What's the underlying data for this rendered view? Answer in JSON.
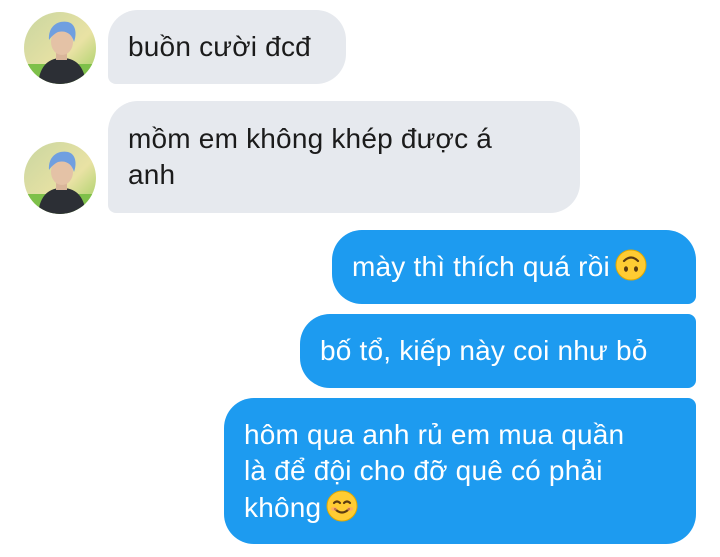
{
  "conversation": {
    "messages": [
      {
        "side": "incoming",
        "lines": [
          "buồn cười đcđ"
        ]
      },
      {
        "side": "incoming",
        "lines": [
          "mồm em không khép được á",
          "anh"
        ]
      },
      {
        "side": "outgoing",
        "text": "mày thì thích quá rồi",
        "emoji": "upside-down-face-icon"
      },
      {
        "side": "outgoing",
        "lines": [
          "bố tổ, kiếp này coi như bỏ"
        ]
      },
      {
        "side": "outgoing",
        "lines": [
          "hôm qua anh rủ em mua quần",
          "là để đội cho đỡ quê có phải"
        ],
        "last_line": "không",
        "emoji": "smiling-face-icon"
      }
    ]
  },
  "colors": {
    "incoming_bubble": "#e6e9ee",
    "outgoing_bubble": "#1d9bf0",
    "incoming_text": "#1b1b1b",
    "outgoing_text": "#ffffff"
  }
}
